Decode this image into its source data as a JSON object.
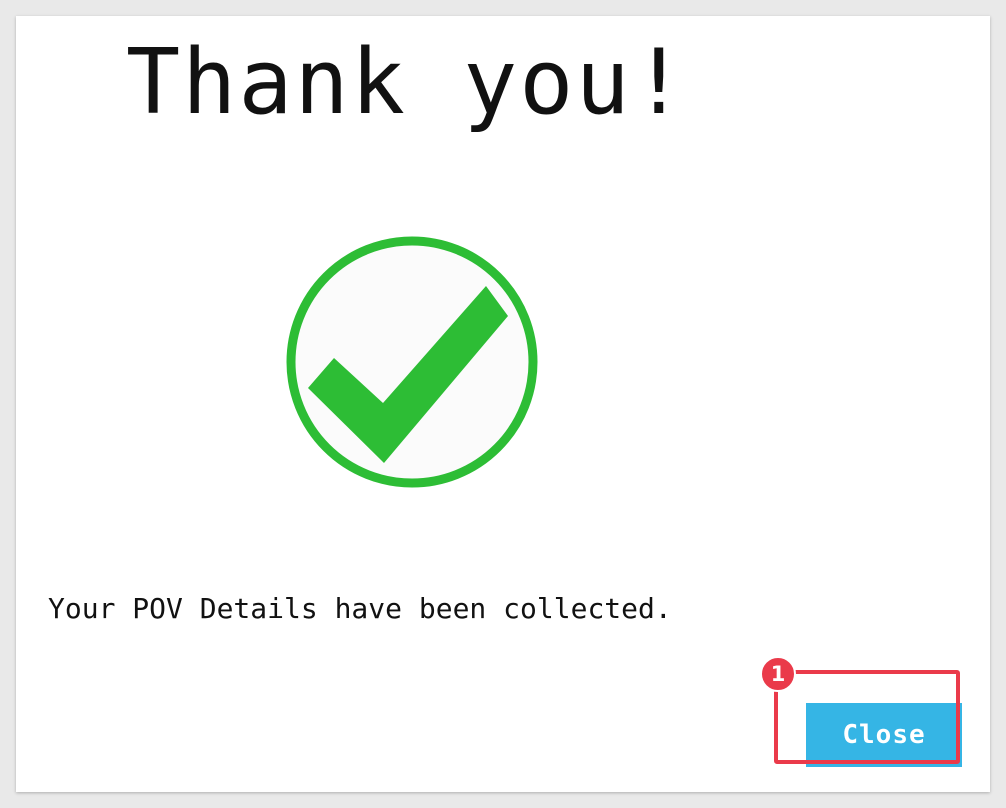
{
  "dialog": {
    "title": "Thank you!",
    "message": "Your POV Details have been collected.",
    "close_label": "Close",
    "success_icon": "check-circle-icon",
    "success_color": "#2dbd35"
  },
  "annotation": {
    "step_number": "1",
    "highlight_color": "#ea3a4a"
  },
  "colors": {
    "button_background": "#35b5e5",
    "page_background": "#e9e9e9"
  }
}
